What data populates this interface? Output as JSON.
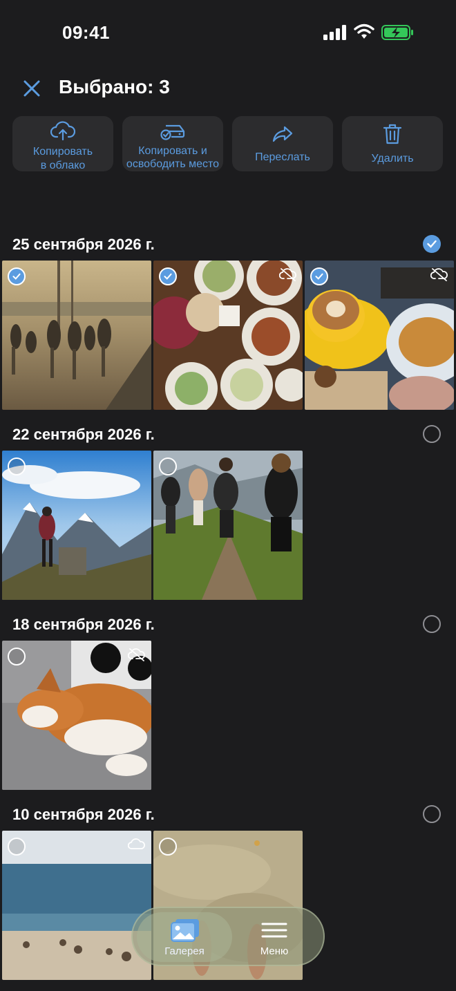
{
  "status": {
    "time": "09:41"
  },
  "header": {
    "title": "Выбрано: 3"
  },
  "actions": [
    {
      "label_line1": "Копировать",
      "label_line2": "в облако",
      "icon": "cloud-upload-icon"
    },
    {
      "label_line1": "Копировать и",
      "label_line2": "освободить место",
      "icon": "drive-check-icon"
    },
    {
      "label_line1": "Переслать",
      "label_line2": "",
      "icon": "forward-icon"
    },
    {
      "label_line1": "Удалить",
      "label_line2": "",
      "icon": "trash-icon"
    }
  ],
  "sections": [
    {
      "date": "25 сентября 2026 г.",
      "selected": true
    },
    {
      "date": "22 сентября 2026 г.",
      "selected": false
    },
    {
      "date": "18 сентября 2026 г.",
      "selected": false
    },
    {
      "date": "10 сентября 2026 г.",
      "selected": false
    }
  ],
  "tabbar": {
    "gallery": "Галерея",
    "menu": "Меню"
  },
  "colors": {
    "accent": "#5b9ce0",
    "background": "#1c1c1e",
    "card": "#2c2c2e"
  }
}
